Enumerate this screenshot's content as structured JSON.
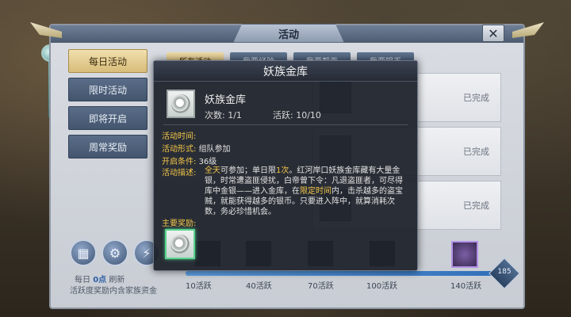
{
  "window": {
    "title": "活动",
    "close_symbol": "✕"
  },
  "tabs": [
    {
      "label": "每日活动",
      "active": true
    },
    {
      "label": "限时活动",
      "active": false
    },
    {
      "label": "即将开启",
      "active": false
    },
    {
      "label": "周常奖励",
      "active": false
    }
  ],
  "subtabs": [
    {
      "label": "所有活动",
      "active": true
    },
    {
      "label": "我要经验",
      "active": false
    },
    {
      "label": "我要帮贡",
      "active": false
    },
    {
      "label": "我要银币",
      "active": false
    }
  ],
  "list": [
    {
      "status": "已完成"
    },
    {
      "status": "已完成"
    },
    {
      "status": "已完成"
    }
  ],
  "bottom": {
    "reset_prefix": "每日",
    "reset_time": "0点",
    "reset_suffix": "刷新",
    "subtitle": "活跃度奖励内含家族资金",
    "milestones": [
      "10活跃",
      "40活跃",
      "70活跃",
      "100活跃",
      "140活跃"
    ],
    "total": "185",
    "progress": 1.0
  },
  "popup": {
    "title": "妖族金库",
    "name": "妖族金库",
    "count_label": "次数: 1/1",
    "active_label": "活跃: 10/10",
    "time_label": "活动时间:",
    "form_label": "活动形式:",
    "form_value": "组队参加",
    "level_label": "开启条件:",
    "level_value": "36级",
    "desc_label": "活动描述:",
    "desc_hl1": "全天",
    "desc_p1": "可参加；单日限",
    "desc_hl2": "1次",
    "desc_p2": "。红河岸口妖族金库藏有大量金银，时常遭盗匪侵扰，白帝曾下令：凡退盗匪者，可尽得库中金银——进入金库，在",
    "desc_hl3": "限定时间",
    "desc_p3": "内，击杀越多的盗宝贼，就能获得越多的银币。只要进入阵中，就算消耗次数，务必珍惜机会。",
    "reward_label": "主要奖励:"
  },
  "colors": {
    "accent_gold": "#f3c64a",
    "reward_green": "#5bd48f"
  }
}
